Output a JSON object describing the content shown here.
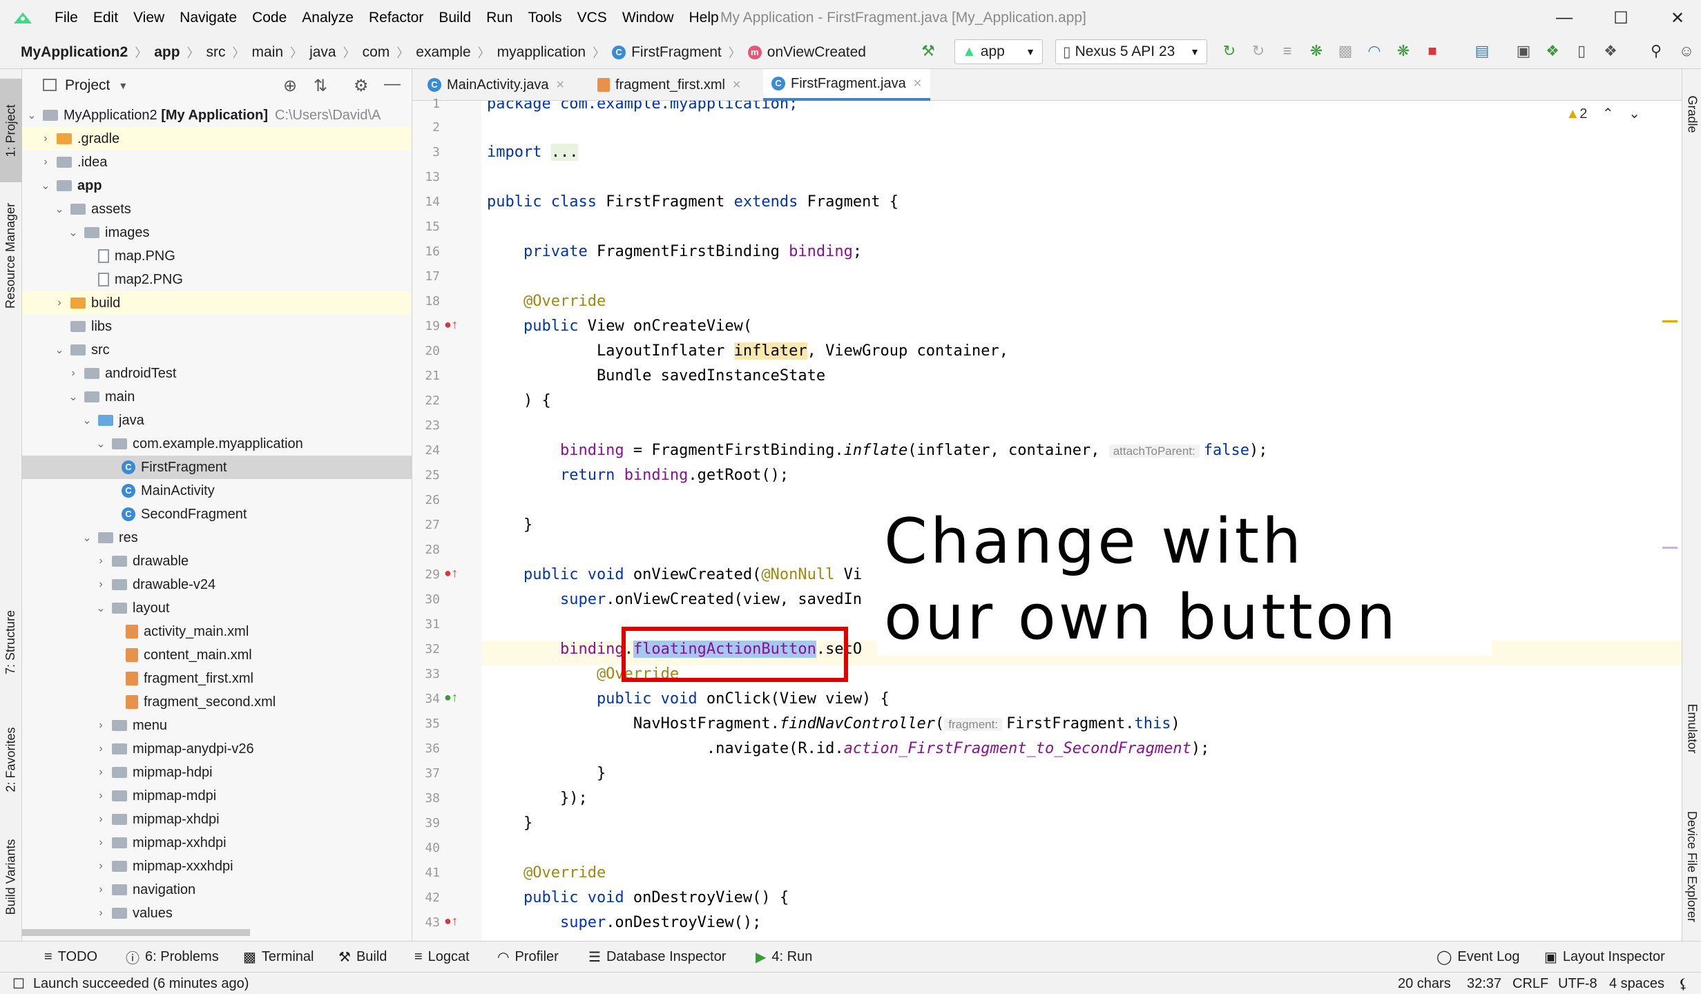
{
  "window": {
    "title": "My Application - FirstFragment.java [My_Application.app]",
    "menu": [
      "File",
      "Edit",
      "View",
      "Navigate",
      "Code",
      "Analyze",
      "Refactor",
      "Build",
      "Run",
      "Tools",
      "VCS",
      "Window",
      "Help"
    ]
  },
  "breadcrumb": [
    "MyApplication2",
    "app",
    "src",
    "main",
    "java",
    "com",
    "example",
    "myapplication",
    "FirstFragment",
    "onViewCreated"
  ],
  "toolbar": {
    "run_config": "app",
    "device": "Nexus 5 API 23"
  },
  "left_stripe": {
    "project": "1: Project",
    "resource_manager": "Resource Manager",
    "structure": "7: Structure",
    "favorites": "2: Favorites",
    "build_variants": "Build Variants"
  },
  "right_stripe": {
    "gradle": "Gradle",
    "emulator": "Emulator",
    "device_file_explorer": "Device File Explorer"
  },
  "project_panel": {
    "title": "Project",
    "root_name": "MyApplication2",
    "root_module": "[My Application]",
    "root_path": "C:\\Users\\David\\A",
    "items": [
      ".gradle",
      ".idea",
      "app",
      "assets",
      "images",
      "map.PNG",
      "map2.PNG",
      "build",
      "libs",
      "src",
      "androidTest",
      "main",
      "java",
      "com.example.myapplication",
      "FirstFragment",
      "MainActivity",
      "SecondFragment",
      "res",
      "drawable",
      "drawable-v24",
      "layout",
      "activity_main.xml",
      "content_main.xml",
      "fragment_first.xml",
      "fragment_second.xml",
      "menu",
      "mipmap-anydpi-v26",
      "mipmap-hdpi",
      "mipmap-mdpi",
      "mipmap-xhdpi",
      "mipmap-xxhdpi",
      "mipmap-xxxhdpi",
      "navigation",
      "values"
    ]
  },
  "editor": {
    "tabs": [
      "MainActivity.java",
      "fragment_first.xml",
      "FirstFragment.java"
    ],
    "warnings": "2",
    "line_numbers": [
      "1",
      "2",
      "3",
      "13",
      "14",
      "15",
      "16",
      "17",
      "18",
      "19",
      "20",
      "21",
      "22",
      "23",
      "24",
      "25",
      "26",
      "27",
      "28",
      "29",
      "30",
      "31",
      "32",
      "33",
      "34",
      "35",
      "36",
      "37",
      "38",
      "39",
      "40",
      "41",
      "42",
      "43"
    ],
    "code": {
      "l1": "package com.example.myapplication;",
      "l3a": "import ",
      "l3b": "...",
      "l14a": "public class ",
      "l14b": "FirstFragment ",
      "l14c": "extends ",
      "l14d": "Fragment {",
      "l16a": "    private ",
      "l16b": "FragmentFirstBinding ",
      "l16c": "binding",
      "l16d": ";",
      "l18": "    @Override",
      "l19a": "    public ",
      "l19b": "View onCreateView(",
      "l20a": "            LayoutInflater ",
      "l20b": "inflater",
      "l20c": ", ViewGroup container,",
      "l21": "            Bundle savedInstanceState",
      "l22": "    ) {",
      "l24a": "        binding",
      "l24b": " = FragmentFirstBinding.",
      "l24c": "inflate",
      "l24d": "(inflater, container, ",
      "l24hint": "attachToParent:",
      "l24e": "false",
      "l24f": ");",
      "l25a": "        return ",
      "l25b": "binding",
      "l25c": ".getRoot();",
      "l27": "    }",
      "l29a": "    public void ",
      "l29b": "onViewCreated(",
      "l29c": "@NonNull",
      "l29d": " Vi",
      "l30a": "        super",
      "l30b": ".onViewCreated(view, savedIn",
      "l32a": "        binding",
      "l32b": ".",
      "l32c": "floatingActionButton",
      "l32d": ".setO",
      "l33": "            @Override",
      "l34a": "            public void ",
      "l34b": "onClick(View view) {",
      "l35a": "                NavHostFragment.",
      "l35b": "findNavController",
      "l35c": "(",
      "l35hint": "fragment:",
      "l35d": "FirstFragment.",
      "l35e": "this",
      "l35f": ")",
      "l36a": "                        .navigate(R.id.",
      "l36b": "action_FirstFragment_to_SecondFragment",
      "l36c": ");",
      "l37": "            }",
      "l38": "        });",
      "l39": "    }",
      "l41": "    @Override",
      "l42a": "    public void ",
      "l42b": "onDestroyView() {",
      "l43a": "        super",
      "l43b": ".onDestroyView();"
    }
  },
  "annotation": {
    "line1": "Change with",
    "line2": "our own button"
  },
  "bottom_tools": [
    "TODO",
    "6: Problems",
    "Terminal",
    "Build",
    "Logcat",
    "Profiler",
    "Database Inspector",
    "4: Run",
    "Event Log",
    "Layout Inspector"
  ],
  "status": {
    "message": "Launch succeeded (6 minutes ago)",
    "chars": "20 chars",
    "position": "32:37",
    "line_sep": "CRLF",
    "encoding": "UTF-8",
    "indent": "4 spaces"
  }
}
